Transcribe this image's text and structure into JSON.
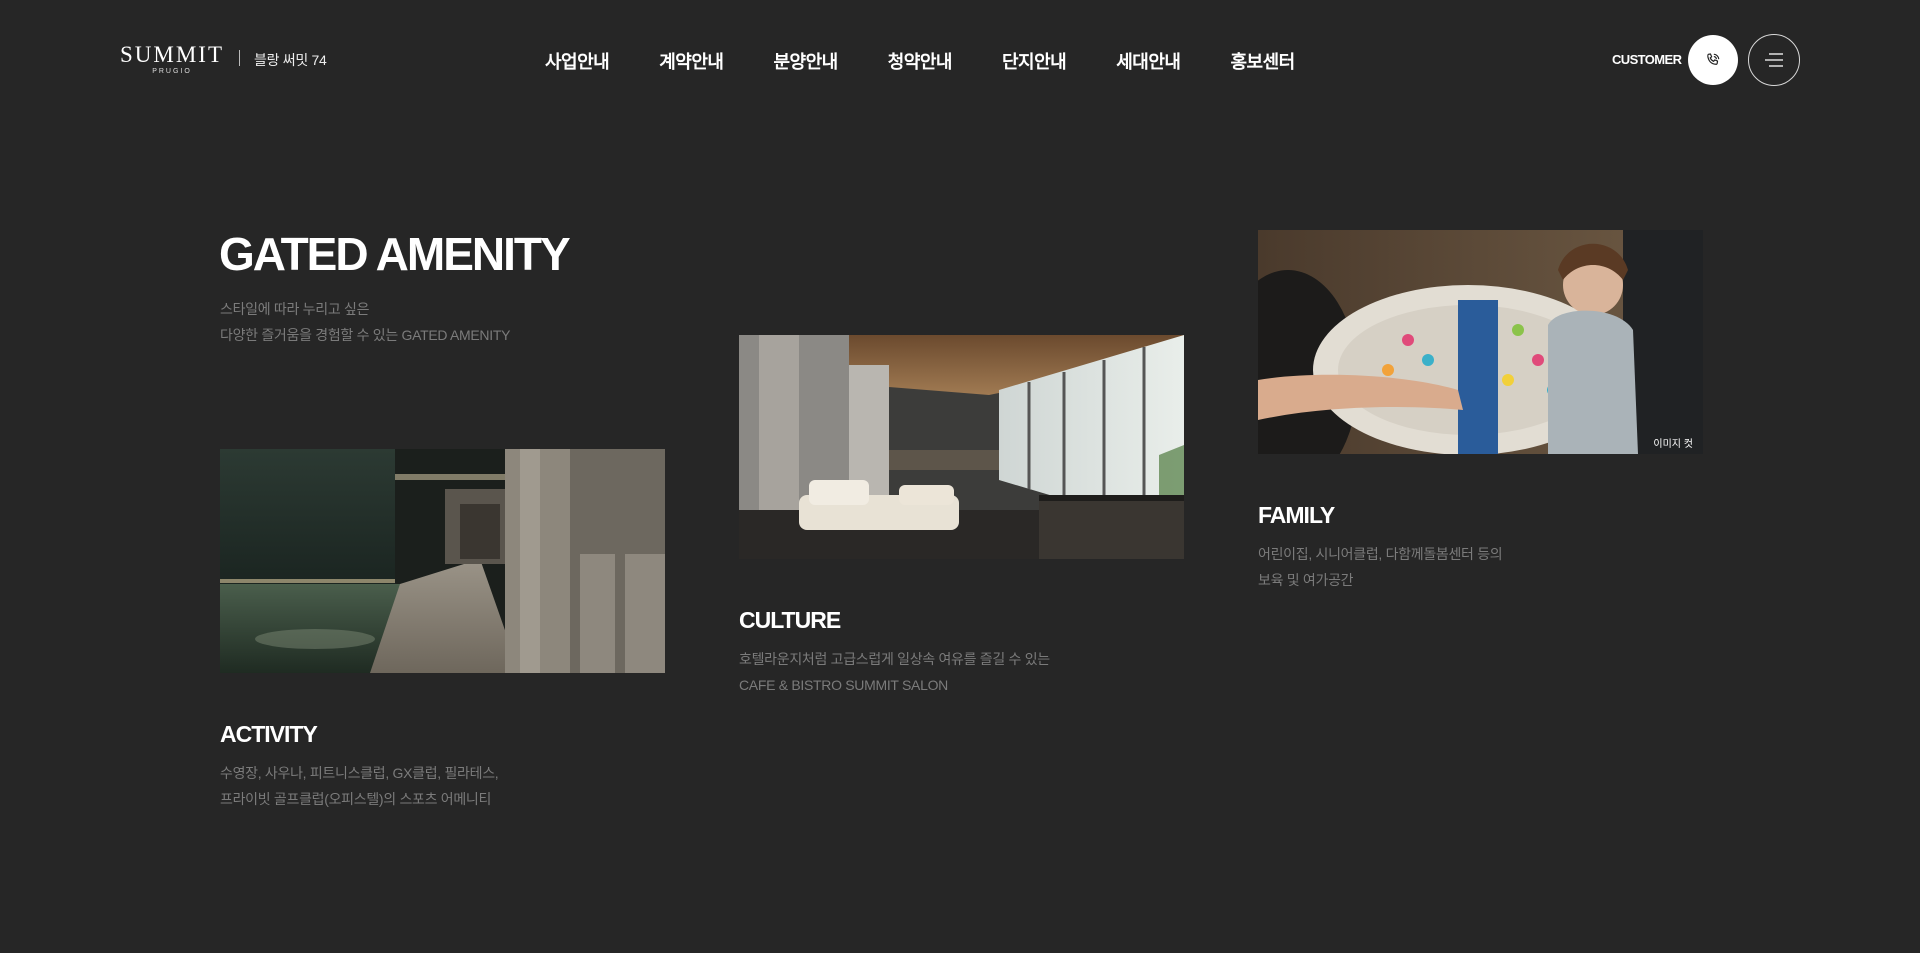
{
  "header": {
    "logo": {
      "main": "SUMMIT",
      "sub": "PRUGIO",
      "site_name": "블랑 써밋 74"
    },
    "nav": [
      "사업안내",
      "계약안내",
      "분양안내",
      "청약안내",
      "단지안내",
      "세대안내",
      "홍보센터"
    ],
    "customer_label": "CUSTOMER",
    "call_icon": "phone-icon",
    "menu_icon": "hamburger-menu-icon"
  },
  "intro": {
    "title": "GATED AMENITY",
    "desc_line1": "스타일에 따라 누리고 싶은",
    "desc_line2": "다양한 즐거움을 경험할 수 있는 GATED AMENITY"
  },
  "cards": [
    {
      "title": "ACTIVITY",
      "desc_line1": "수영장, 사우나, 피트니스클럽, GX클럽, 필라테스,",
      "desc_line2": "프라이빗 골프클럽(오피스텔)의 스포츠 어메니티"
    },
    {
      "title": "CULTURE",
      "desc_line1": "호텔라운지처럼 고급스럽게 일상속 여유를 즐길 수 있는",
      "desc_line2": "CAFE & BISTRO SUMMIT SALON"
    },
    {
      "title": "FAMILY",
      "desc_line1": "어린이집, 시니어클럽, 다함께돌봄센터 등의",
      "desc_line2": "보육 및 여가공간",
      "image_caption": "이미지 컷"
    }
  ],
  "colors": {
    "background": "#262626",
    "text": "#ffffff",
    "muted": "#7b7b7b"
  }
}
